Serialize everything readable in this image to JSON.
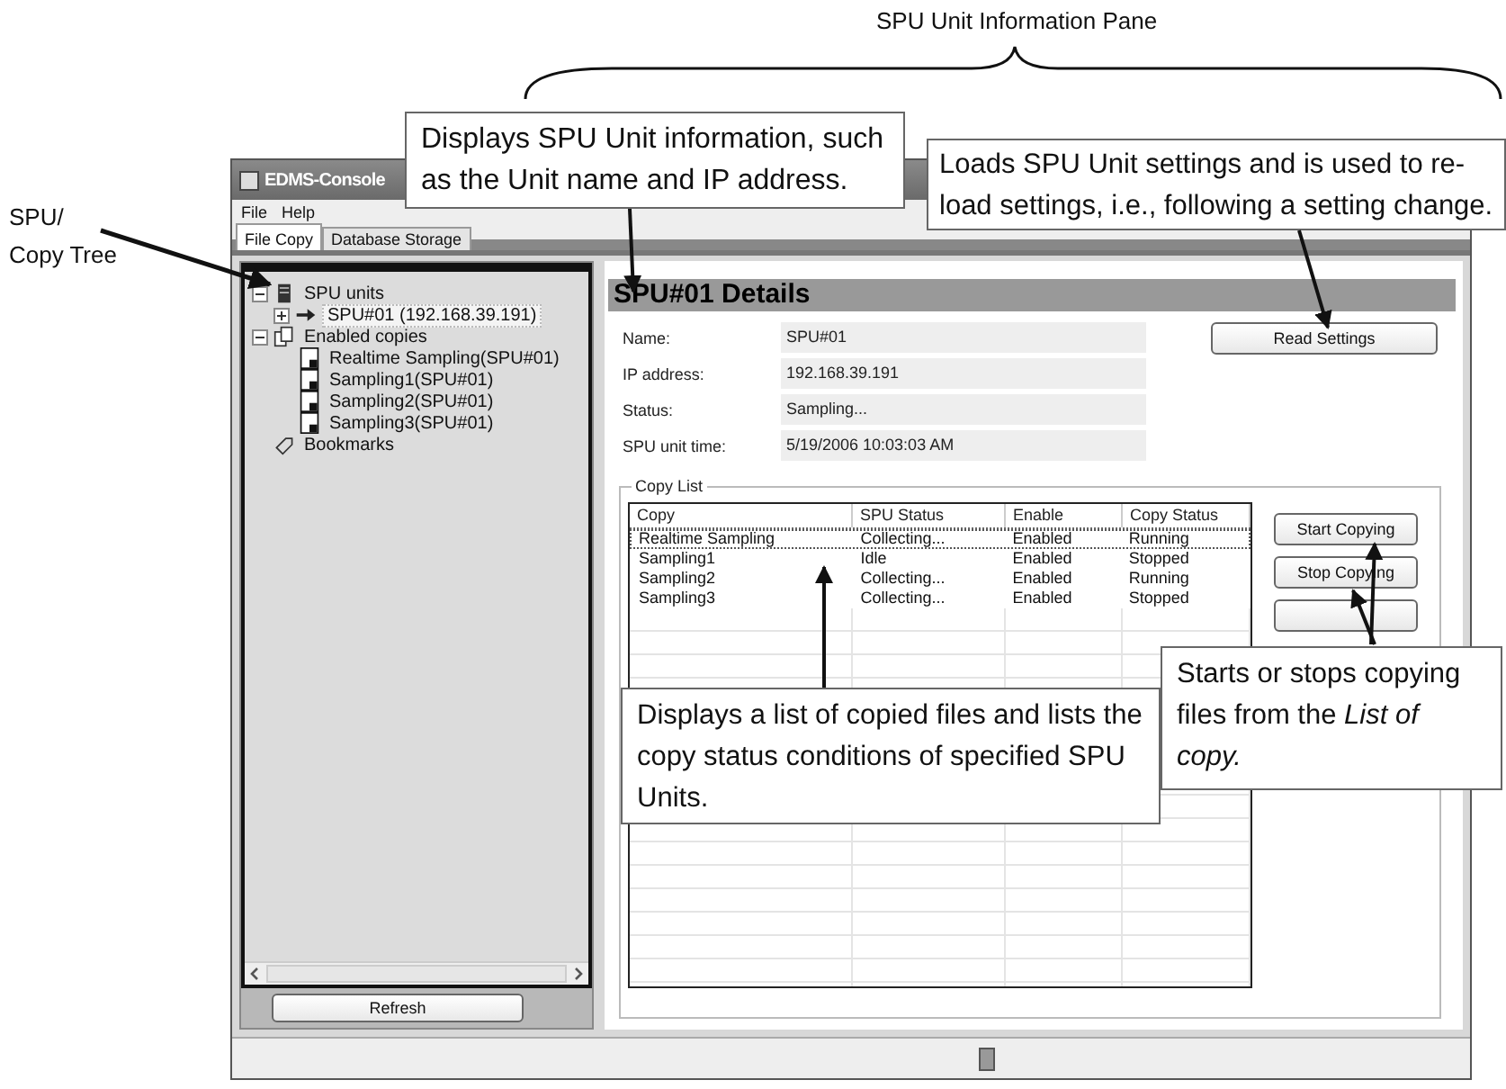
{
  "annotations": {
    "pane_label": "SPU Unit Information Pane",
    "tree_label": [
      "SPU/",
      "Copy Tree"
    ],
    "callouts": [
      {
        "kind": "info",
        "text": "Displays SPU Unit information, such as the Unit name and IP address."
      },
      {
        "kind": "read",
        "text": "Loads SPU Unit settings and is used to re-load settings, i.e., following a setting change."
      },
      {
        "kind": "list",
        "text": "Displays a list of copied files and lists the copy status conditions of specified SPU Units."
      },
      {
        "kind": "copy",
        "text": "Starts or stops copying files from the *List of copy.*"
      }
    ]
  },
  "window": {
    "title": "EDMS-Console",
    "menu": [
      "File",
      "Help"
    ],
    "tabs": [
      {
        "label": "File Copy",
        "selected": true
      },
      {
        "label": "Database Storage",
        "selected": false
      }
    ],
    "tree": [
      {
        "label": "SPU units",
        "kind": "server",
        "expanded": true,
        "selected": false,
        "children": [
          {
            "label": "SPU#01 (192.168.39.191)",
            "kind": "unit",
            "expanded": false,
            "selected": true
          }
        ]
      },
      {
        "label": "Enabled copies",
        "kind": "copies",
        "expanded": true,
        "selected": false,
        "children": [
          {
            "label": "Realtime Sampling(SPU#01)",
            "kind": "file",
            "selected": false
          },
          {
            "label": "Sampling1(SPU#01)",
            "kind": "file",
            "selected": false
          },
          {
            "label": "Sampling2(SPU#01)",
            "kind": "file",
            "selected": false
          },
          {
            "label": "Sampling3(SPU#01)",
            "kind": "file",
            "selected": false
          }
        ]
      },
      {
        "label": "Bookmarks",
        "kind": "bookmark",
        "selected": false
      }
    ],
    "refresh_button": "Refresh",
    "details": {
      "title": "SPU#01 Details",
      "read_button": "Read Settings",
      "fields": [
        {
          "label": "Name:",
          "value": "SPU#01"
        },
        {
          "label": "IP address:",
          "value": "192.168.39.191"
        },
        {
          "label": "Status:",
          "value": "Sampling..."
        },
        {
          "label": "SPU unit time:",
          "value": "5/19/2006 10:03:03 AM"
        }
      ]
    },
    "copy_list": {
      "title": "Copy List",
      "columns": [
        "Copy",
        "SPU Status",
        "Enable",
        "Copy Status"
      ],
      "rows": [
        {
          "cells": [
            "Realtime Sampling",
            "Collecting...",
            "Enabled",
            "Running"
          ],
          "focused": true
        },
        {
          "cells": [
            "Sampling1",
            "Idle",
            "Enabled",
            "Stopped"
          ],
          "focused": false
        },
        {
          "cells": [
            "Sampling2",
            "Collecting...",
            "Enabled",
            "Running"
          ],
          "focused": false
        },
        {
          "cells": [
            "Sampling3",
            "Collecting...",
            "Enabled",
            "Stopped"
          ],
          "focused": false
        }
      ],
      "buttons": [
        "Start Copying",
        "Stop Copying"
      ]
    }
  }
}
